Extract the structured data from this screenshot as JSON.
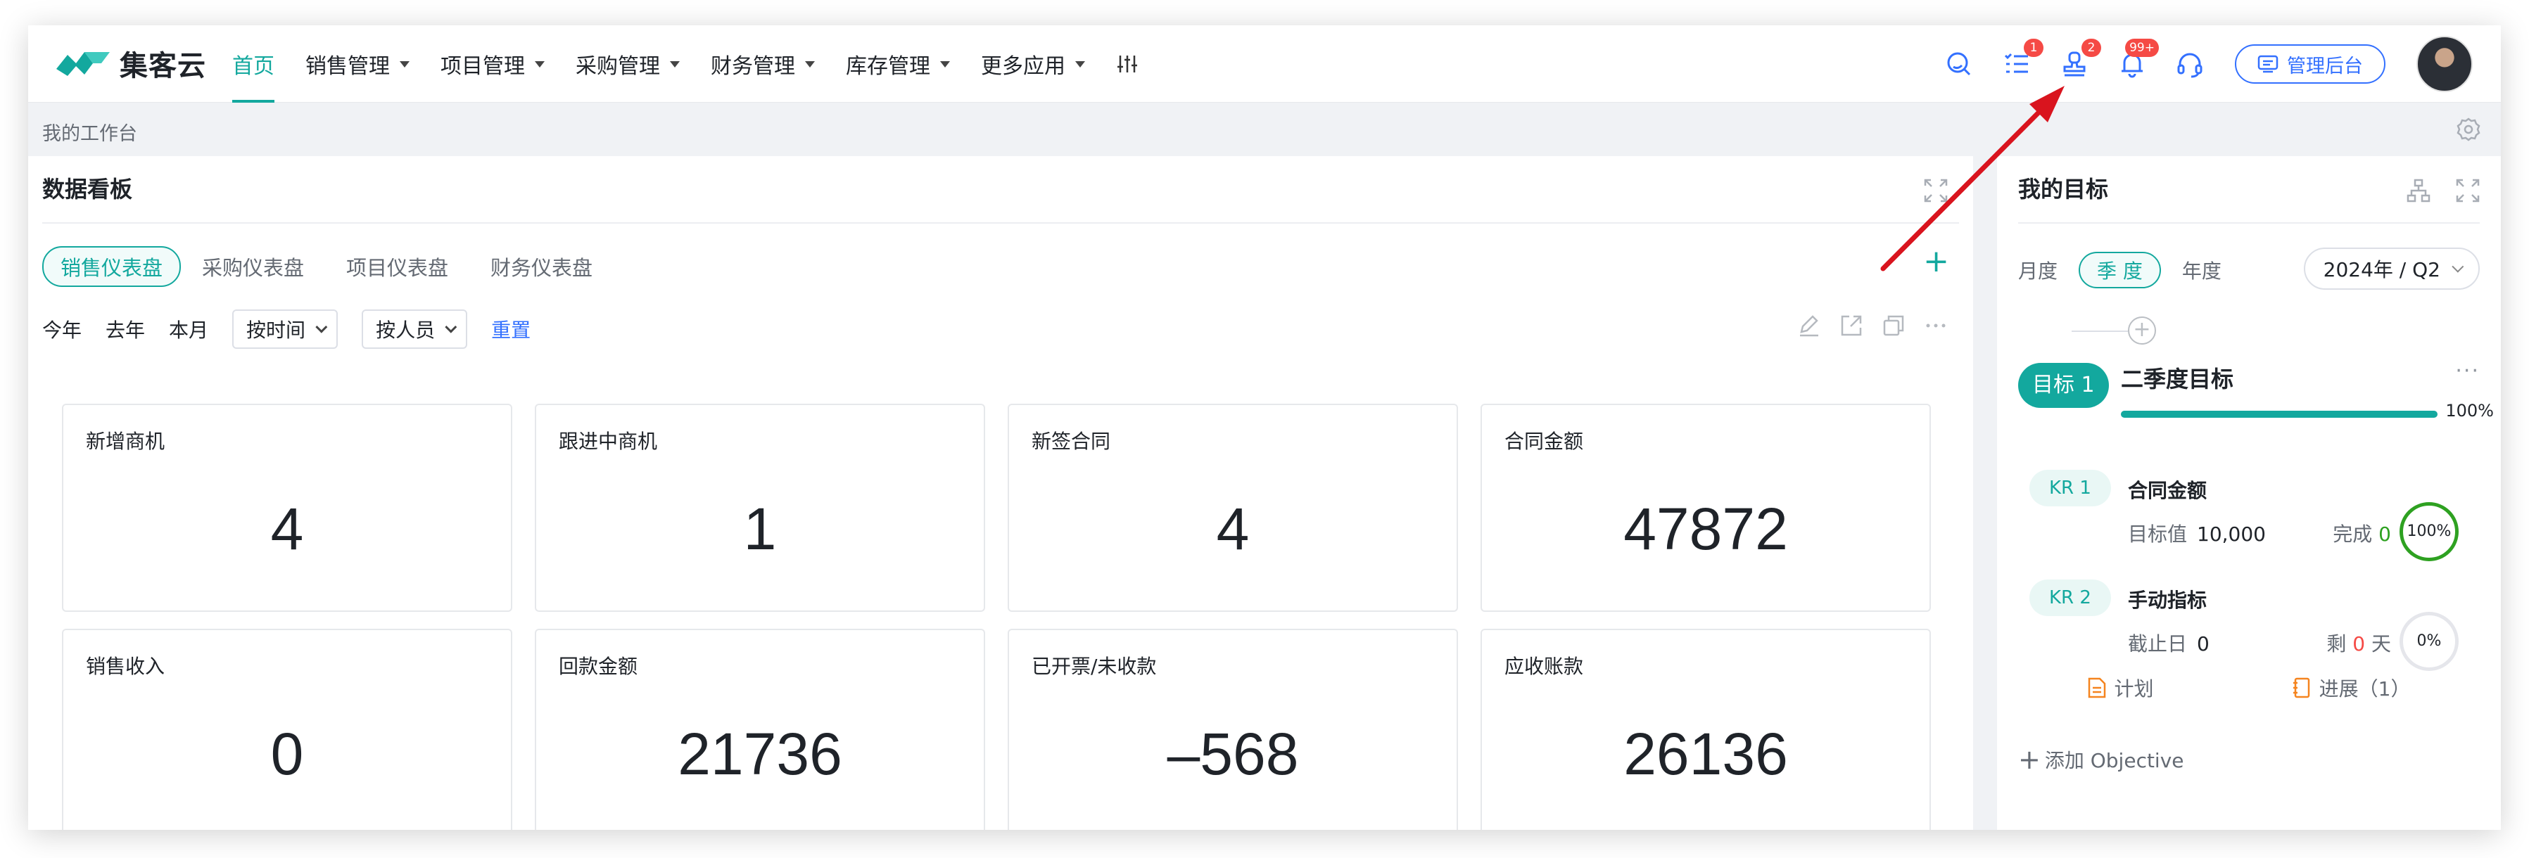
{
  "logo": {
    "text": "集客云"
  },
  "nav": [
    {
      "label": "首页",
      "active": true,
      "dropdown": false
    },
    {
      "label": "销售管理",
      "dropdown": true
    },
    {
      "label": "项目管理",
      "dropdown": true
    },
    {
      "label": "采购管理",
      "dropdown": true
    },
    {
      "label": "财务管理",
      "dropdown": true
    },
    {
      "label": "库存管理",
      "dropdown": true
    },
    {
      "label": "更多应用",
      "dropdown": true
    }
  ],
  "toolbar": {
    "task_badge": "1",
    "approval_badge": "2",
    "notify_badge": "99+",
    "admin_label": "管理后台"
  },
  "breadcrumb": "我的工作台",
  "dashboard": {
    "title": "数据看板",
    "tabs": [
      "销售仪表盘",
      "采购仪表盘",
      "项目仪表盘",
      "财务仪表盘"
    ],
    "filters": {
      "today": "今年",
      "last_year": "去年",
      "this_month": "本月",
      "by_time": "按时间",
      "by_person": "按人员",
      "reset": "重置"
    },
    "cards": [
      {
        "label": "新增商机",
        "value": "4"
      },
      {
        "label": "跟进中商机",
        "value": "1"
      },
      {
        "label": "新签合同",
        "value": "4"
      },
      {
        "label": "合同金额",
        "value": "47872"
      },
      {
        "label": "销售收入",
        "value": "0"
      },
      {
        "label": "回款金额",
        "value": "21736"
      },
      {
        "label": "已开票/未收款",
        "value": "–568"
      },
      {
        "label": "应收账款",
        "value": "26136"
      }
    ]
  },
  "goals": {
    "title": "我的目标",
    "periods": [
      "月度",
      "季 度",
      "年度"
    ],
    "quarter": "2024年 / Q2",
    "objective": {
      "tag": "目标 1",
      "title": "二季度目标",
      "progress_pct": 100,
      "progress_label": "100%"
    },
    "krs": [
      {
        "tag": "KR 1",
        "name": "合同金额",
        "sub_label": "目标值",
        "sub_value": "10,000",
        "right_prefix": "完成",
        "right_value": "0",
        "right_suffix": "",
        "ring": "100%"
      },
      {
        "tag": "KR 2",
        "name": "手动指标",
        "sub_label": "截止日",
        "sub_value": "0",
        "right_prefix": "剩",
        "right_value": "0",
        "right_suffix": "天",
        "ring": "0%"
      }
    ],
    "plan_label": "计划",
    "progress_label": "进展（1）",
    "add_objective": "添加 Objective"
  },
  "colors": {
    "brand": "#13a89e",
    "accent_blue": "#3370ff",
    "badge_red": "#f54a45",
    "arrow_red": "#d9141e"
  }
}
